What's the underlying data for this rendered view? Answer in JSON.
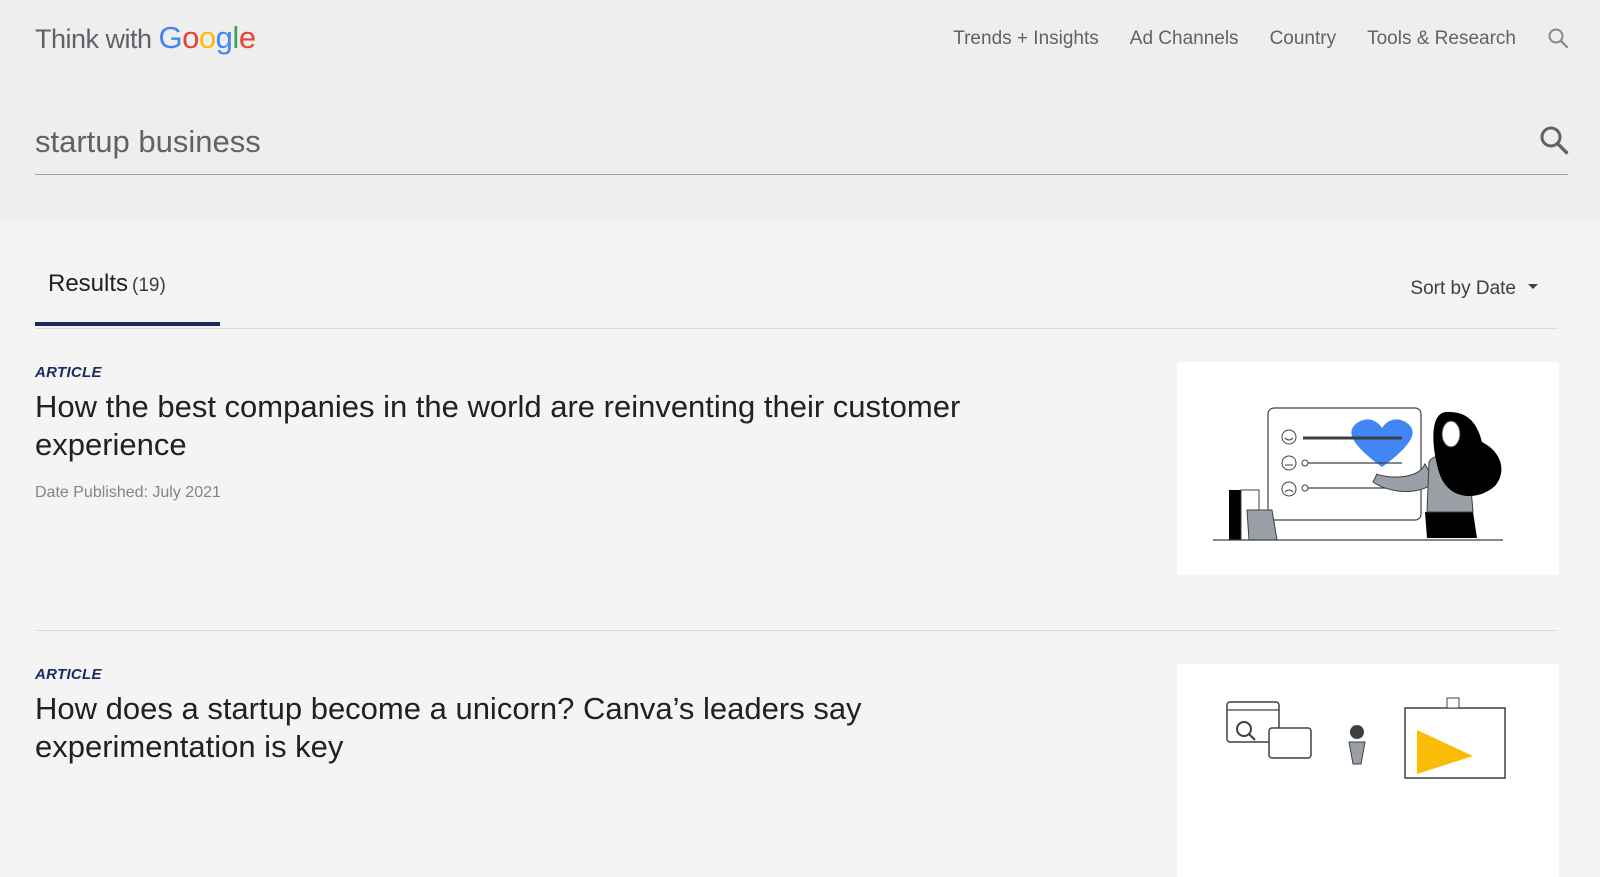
{
  "header": {
    "logo": {
      "think_text": "Think with",
      "google_letters": [
        "G",
        "o",
        "o",
        "g",
        "l",
        "e"
      ],
      "google_colors": [
        "#4285F4",
        "#EA4335",
        "#FBBC05",
        "#4285F4",
        "#34A853",
        "#EA4335"
      ]
    },
    "nav": [
      {
        "label": "Trends + Insights"
      },
      {
        "label": "Ad Channels"
      },
      {
        "label": "Country"
      },
      {
        "label": "Tools & Research"
      }
    ],
    "nav_search_icon": "search-icon"
  },
  "search": {
    "value": "startup business",
    "submit_icon": "search-icon"
  },
  "tabs": {
    "results_label": "Results",
    "results_count": "(19)"
  },
  "sort": {
    "label": "Sort by Date",
    "icon": "caret-down-icon"
  },
  "results": [
    {
      "type": "ARTICLE",
      "title": "How the best companies in the world are reinventing their customer experience",
      "date": "Date Published: July 2021",
      "image_icon": "customer-feedback-illustration"
    },
    {
      "type": "ARTICLE",
      "title": "How does a startup become a unicorn? Canva’s leaders say experimentation is key",
      "image_icon": "startup-experimentation-illustration"
    }
  ],
  "colors": {
    "accent_navy": "#1a2a5e",
    "heart_blue": "#4285F4",
    "play_yellow": "#FBBC05"
  }
}
